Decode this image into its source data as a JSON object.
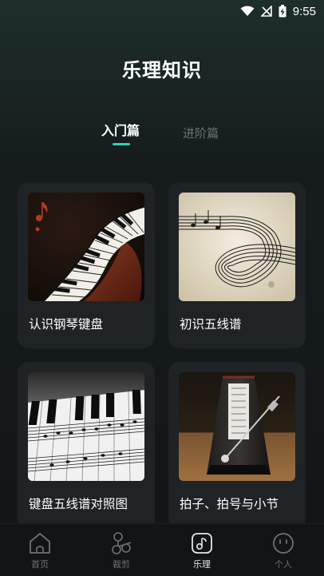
{
  "status_bar": {
    "time": "9:55",
    "icons": [
      "wifi-icon",
      "signal-muted-icon",
      "battery-charging-icon"
    ]
  },
  "page": {
    "title": "乐理知识"
  },
  "tabs": [
    {
      "label": "入门篇",
      "active": true
    },
    {
      "label": "进阶篇",
      "active": false
    }
  ],
  "cards": [
    {
      "title": "认识钢琴键盘",
      "image": "piano-keyboard-illustration"
    },
    {
      "title": "初识五线谱",
      "image": "staff-lines-illustration"
    },
    {
      "title": "键盘五线谱对照图",
      "image": "keyboard-staff-chart-illustration"
    },
    {
      "title": "拍子、拍号与小节",
      "image": "metronome-illustration"
    }
  ],
  "bottom_nav": [
    {
      "label": "首页",
      "icon": "home-icon",
      "active": false
    },
    {
      "label": "裁剪",
      "icon": "scissors-icon",
      "active": false
    },
    {
      "label": "乐理",
      "icon": "music-note-icon",
      "active": true
    },
    {
      "label": "个人",
      "icon": "smiley-icon",
      "active": false
    }
  ],
  "colors": {
    "accent": "#2fd3b4",
    "background": "#121517",
    "card": "#1f2325",
    "inactive_text": "#6b7274"
  }
}
